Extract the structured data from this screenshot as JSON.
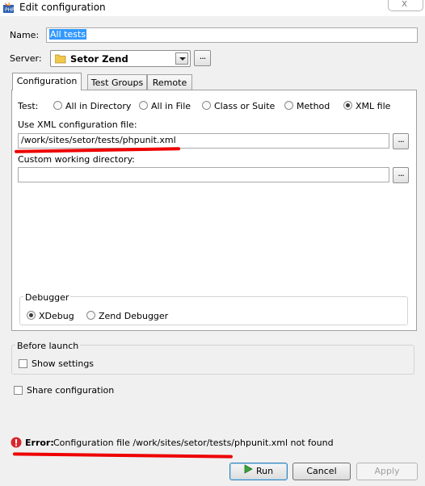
{
  "window": {
    "title": "Edit configuration",
    "close_glyph": "x"
  },
  "form": {
    "name_label": "Name:",
    "name_value": "All tests",
    "server_label": "Server:",
    "server_value": "Setor Zend",
    "browse_label": "..."
  },
  "tabs": [
    {
      "label": "Configuration",
      "active": true
    },
    {
      "label": "Test Groups",
      "active": false
    },
    {
      "label": "Remote",
      "active": false
    }
  ],
  "test": {
    "label": "Test:",
    "options": [
      "All in Directory",
      "All in File",
      "Class or Suite",
      "Method",
      "XML file"
    ],
    "selected": "XML file"
  },
  "xml_config": {
    "label": "Use XML configuration file:",
    "value": "/work/sites/setor/tests/phpunit.xml"
  },
  "working_dir": {
    "label": "Custom working directory:",
    "value": ""
  },
  "debugger": {
    "title": "Debugger",
    "options": [
      "XDebug",
      "Zend Debugger"
    ],
    "selected": "XDebug"
  },
  "before_launch": {
    "title": "Before launch",
    "show_settings_label": "Show settings",
    "checked": false
  },
  "share": {
    "label": "Share configuration",
    "checked": false
  },
  "error": {
    "prefix": "Error:",
    "message": "Configuration file /work/sites/setor/tests/phpunit.xml not found"
  },
  "buttons": {
    "run": "Run",
    "cancel": "Cancel",
    "apply": "Apply"
  },
  "colors": {
    "annotation": "#ee0000",
    "error_icon": "#d9262c",
    "run_icon": "#3aa33a",
    "selection": "#3399ff"
  }
}
